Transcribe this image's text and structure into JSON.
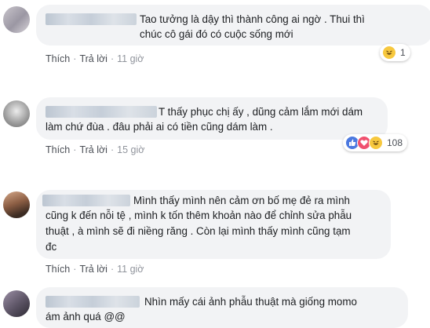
{
  "comments": [
    {
      "lines": [
        "Tao tưởng là dậy thì thành công ai ngờ . Thui thì",
        "chúc cô gái đó có cuộc sống mới"
      ],
      "like": "Thích",
      "reply": "Trả lời",
      "time": "11 giờ",
      "reactions": [
        "haha"
      ],
      "reaction_count": "1"
    },
    {
      "lines": [
        "T thấy phục chị ấy , dũng cảm lắm mới dám",
        "làm chứ đùa . đâu phải ai có tiền cũng dám làm ."
      ],
      "like": "Thích",
      "reply": "Trả lời",
      "time": "15 giờ",
      "reactions": [
        "like",
        "love",
        "haha"
      ],
      "reaction_count": "108"
    },
    {
      "lines": [
        "Mình thấy mình nên cảm ơn bố mẹ đẻ ra mình",
        "cũng k đến nỗi tệ , mình k tốn thêm khoản nào để chỉnh sửa phẫu",
        "thuật , à mình sẽ đi niềng răng . Còn lại mình thấy mình cũng tạm",
        "đc"
      ],
      "like": "Thích",
      "reply": "Trả lời",
      "time": "11 giờ"
    },
    {
      "lines": [
        "Nhìn mấy cái ảnh phẫu thuật mà giống momo",
        "ám ảnh quá @@"
      ]
    }
  ],
  "colors": {
    "bubble": "#f2f3f5",
    "meta": "#90949c",
    "action": "#4b4f56",
    "like_blue": "#4c79e0",
    "love_red": "#f0506e",
    "haha_yellow": "#f7c83e"
  }
}
